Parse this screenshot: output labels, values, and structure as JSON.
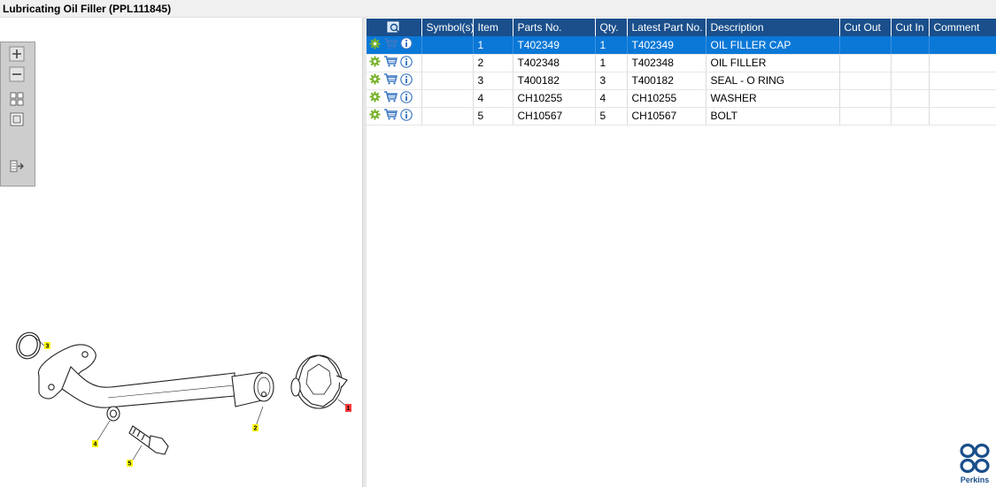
{
  "window": {
    "title": "Lubricating Oil Filler (PPL111845)"
  },
  "toolbar": {
    "icons": [
      "zoom-in-icon",
      "zoom-out-icon",
      "fit-all-icon",
      "fit-window-icon",
      "export-icon"
    ]
  },
  "drawing": {
    "callouts": [
      "1",
      "2",
      "3",
      "4",
      "5"
    ],
    "colors": {
      "callout_yellow": "#ffff00",
      "callout_red": "#ff3b3b"
    }
  },
  "grid": {
    "headers": {
      "symbols": "Symbol(s)",
      "item": "Item",
      "parts_no": "Parts No.",
      "qty": "Qty.",
      "latest_part_no": "Latest Part No.",
      "description": "Description",
      "cut_out": "Cut Out",
      "cut_in": "Cut In",
      "comment": "Comment"
    },
    "rows": [
      {
        "item": "1",
        "parts_no": "T402349",
        "qty": "1",
        "latest_part_no": "T402349",
        "description": "OIL FILLER CAP",
        "selected": true
      },
      {
        "item": "2",
        "parts_no": "T402348",
        "qty": "1",
        "latest_part_no": "T402348",
        "description": "OIL FILLER",
        "selected": false
      },
      {
        "item": "3",
        "parts_no": "T400182",
        "qty": "3",
        "latest_part_no": "T400182",
        "description": "SEAL - O RING",
        "selected": false
      },
      {
        "item": "4",
        "parts_no": "CH10255",
        "qty": "4",
        "latest_part_no": "CH10255",
        "description": "WASHER",
        "selected": false
      },
      {
        "item": "5",
        "parts_no": "CH10567",
        "qty": "5",
        "latest_part_no": "CH10567",
        "description": "BOLT",
        "selected": false
      }
    ],
    "row_icons": [
      "settings-gear-icon",
      "cart-icon",
      "info-icon"
    ]
  },
  "brand": {
    "name": "Perkins",
    "color": "#1a4f8b"
  },
  "colors": {
    "header_bg": "#1a4f8b",
    "selected_row": "#0a78d7"
  }
}
